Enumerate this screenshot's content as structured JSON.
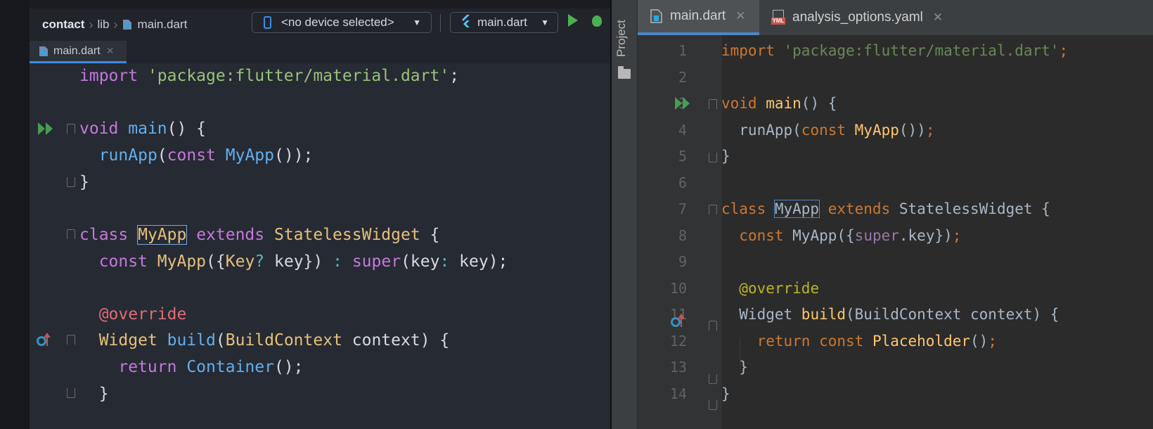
{
  "left": {
    "breadcrumb": {
      "project": "contact",
      "folder": "lib",
      "file": "main.dart"
    },
    "device_selector": {
      "label": "<no device selected>"
    },
    "run_config": {
      "label": "main.dart"
    },
    "tab": {
      "label": "main.dart"
    },
    "code": [
      "import 'package:flutter/material.dart';",
      "",
      "void main() {",
      "  runApp(const MyApp());",
      "}",
      "",
      "class MyApp extends StatelessWidget {",
      "  const MyApp({Key? key}) : super(key: key);",
      "",
      "  @override",
      "  Widget build(BuildContext context) {",
      "    return Container();",
      "  }"
    ]
  },
  "right": {
    "sidebar": {
      "project_label": "Project"
    },
    "tabs": [
      {
        "label": "main.dart",
        "active": true
      },
      {
        "label": "analysis_options.yaml",
        "active": false
      }
    ],
    "yaml_icon_label": "YML",
    "line_numbers": [
      "1",
      "2",
      "3",
      "4",
      "5",
      "6",
      "7",
      "8",
      "9",
      "10",
      "11",
      "12",
      "13",
      "14"
    ],
    "code": [
      "import 'package:flutter/material.dart';",
      "",
      "void main() {",
      "  runApp(const MyApp());",
      "}",
      "",
      "class MyApp extends StatelessWidget {",
      "  const MyApp({super.key});",
      "",
      "  @override",
      "  Widget build(BuildContext context) {",
      "    return const Placeholder();",
      "  }",
      "}"
    ]
  },
  "colors": {
    "left_bg": "#262a33",
    "right_bg": "#2b2b2b",
    "accent_blue": "#3d8be6",
    "run_green": "#4caf50"
  },
  "icons": [
    "dart-file-icon",
    "phone-icon",
    "flutter-icon",
    "run-icon",
    "debug-icon",
    "close-icon",
    "folder-icon",
    "yaml-file-icon",
    "run-gutter-icon",
    "override-gutter-icon"
  ]
}
